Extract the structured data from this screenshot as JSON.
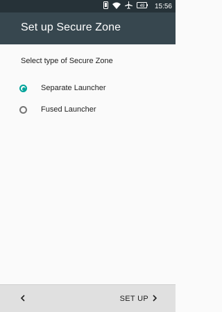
{
  "status_bar": {
    "time": "15:56",
    "battery": "49",
    "icons": [
      "phone-icon",
      "wifi-icon",
      "airplane-icon",
      "battery-icon"
    ]
  },
  "app_bar": {
    "title": "Set up Secure Zone"
  },
  "content": {
    "prompt": "Select type of Secure Zone",
    "options": [
      {
        "label": "Separate Launcher",
        "selected": true
      },
      {
        "label": "Fused Launcher",
        "selected": false
      }
    ]
  },
  "bottom_bar": {
    "back_icon": "chevron-left-icon",
    "next_label": "SET UP",
    "next_icon": "chevron-right-icon"
  },
  "colors": {
    "status_bar": "#263238",
    "app_bar": "#37474f",
    "accent": "#00a39a",
    "background": "#fafafa",
    "bottom_bar": "#e0e0e0"
  }
}
